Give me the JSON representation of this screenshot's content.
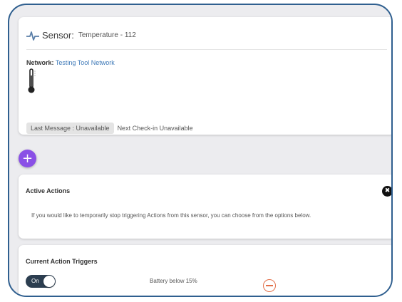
{
  "sensor": {
    "title_label": "Sensor:",
    "title_value": "Temperature - 112",
    "network_label": "Network:",
    "network_value": "Testing Tool Network",
    "last_message": "Last Message : Unavailable",
    "next_checkin": "Next Check-in Unavailable",
    "icons": [
      "pulse-icon",
      "thermometer-icon"
    ]
  },
  "add_button": {
    "label": "+",
    "color": "#8a50e6"
  },
  "active_actions": {
    "title": "Active Actions",
    "close_label": "✖",
    "description": "If you would like to temporarily stop triggering Actions from this sensor, you can choose from the options below."
  },
  "current_triggers": {
    "title": "Current Action Triggers",
    "items": [
      {
        "toggle_label": "On",
        "enabled": true,
        "text": "Battery below 15%"
      }
    ]
  },
  "colors": {
    "frame_border": "#2f5f8f",
    "link_blue": "#3e79b8",
    "accent_purple": "#8a50e6",
    "toggle_dark": "#2c3e50",
    "remove_orange": "#e2704a"
  }
}
